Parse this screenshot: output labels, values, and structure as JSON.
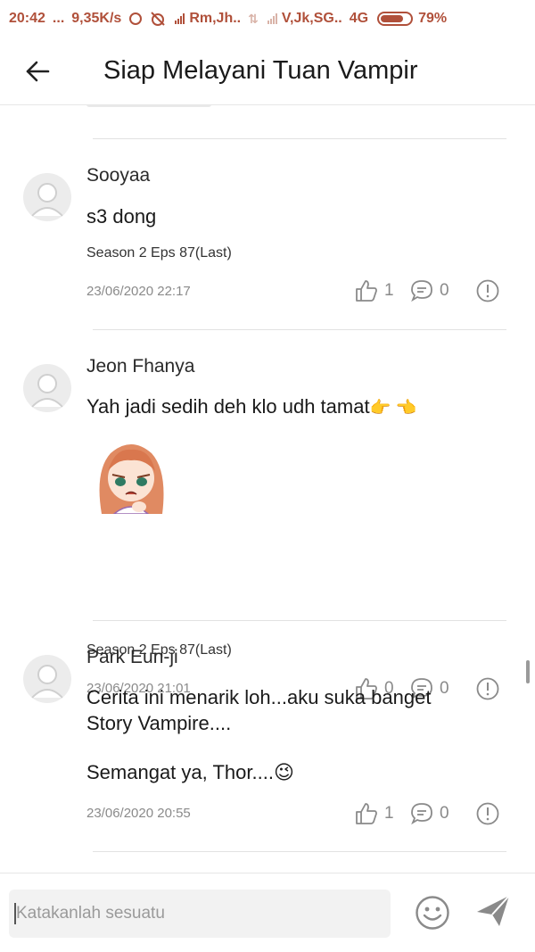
{
  "status_bar": {
    "time": "20:42",
    "dots": "...",
    "speed": "9,35K/s",
    "carrier1": "Rm,Jh..",
    "carrier2": "V,Jk,SG..",
    "network": "4G",
    "battery": "79%",
    "battery_level": 0.79
  },
  "header": {
    "title": "Siap Melayani Tuan Vampir",
    "back_icon": "arrow-left-icon"
  },
  "comments": [
    {
      "user": "Sooyaa",
      "text": "s3 dong",
      "episode": "Season 2 Eps 87(Last)",
      "date": "23/06/2020 22:17",
      "likes": "1",
      "replies": "0"
    },
    {
      "user": "Jeon Fhanya",
      "text": "Yah jadi sedih deh klo udh tamat",
      "text_emoji": "👉 👈",
      "sticker": "crying-girl-sticker",
      "episode": "Season 2 Eps 87(Last)",
      "date": "23/06/2020 21:01",
      "likes": "0",
      "replies": "0"
    },
    {
      "user": "Park Eun-ji",
      "text_line1": "Cerita ini menarik loh...aku suka banget",
      "text_line2": "Story Vampire....",
      "text_line3": "Semangat ya, Thor....",
      "text_emoji": "😉",
      "date": "23/06/2020 20:55",
      "likes": "1",
      "replies": "0"
    }
  ],
  "footer": {
    "placeholder": "Katakanlah sesuatu",
    "emoji_icon": "smiley-icon",
    "send_icon": "send-icon"
  },
  "colors": {
    "status": "#b0503a",
    "icon_gray": "#8a8a8a",
    "divider": "#e2e2e2",
    "emoji_pink": "#e0408a"
  }
}
